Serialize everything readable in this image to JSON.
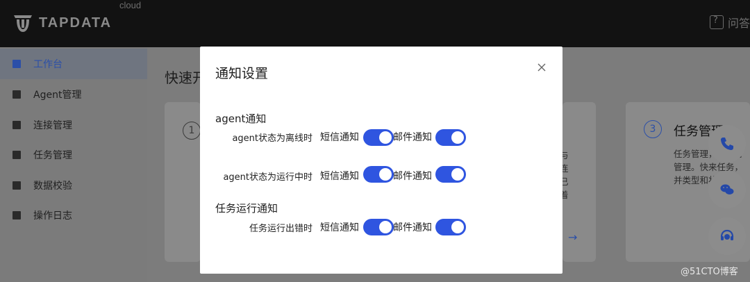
{
  "app": {
    "logo_text": "TAPDATA",
    "logo_sup": "cloud",
    "help_label": "问答"
  },
  "sidebar": {
    "items": [
      {
        "label": "工作台",
        "active": true
      },
      {
        "label": "Agent管理"
      },
      {
        "label": "连接管理"
      },
      {
        "label": "任务管理"
      },
      {
        "label": "数据校验"
      },
      {
        "label": "操作日志"
      }
    ]
  },
  "main": {
    "title": "快速开",
    "card1_num": "1",
    "card2_partial": "与连已着",
    "card3": {
      "num": "3",
      "title": "任务管理",
      "text": "任务管理，并进行管理。快来任务，并类型和状"
    }
  },
  "modal": {
    "title": "通知设置",
    "sections": [
      {
        "title": "agent通知",
        "rows": [
          {
            "label": "agent状态为离线时",
            "sms_label": "短信通知",
            "sms_on": true,
            "email_label": "邮件通知",
            "email_on": true
          },
          {
            "label": "agent状态为运行中时",
            "sms_label": "短信通知",
            "sms_on": true,
            "email_label": "邮件通知",
            "email_on": true
          }
        ]
      },
      {
        "title": "任务运行通知",
        "rows": [
          {
            "label": "任务运行出错时",
            "sms_label": "短信通知",
            "sms_on": true,
            "email_label": "邮件通知",
            "email_on": true
          }
        ]
      }
    ]
  },
  "watermark": "@51CTO博客",
  "colors": {
    "accent": "#2f55e0",
    "topbar": "#121212",
    "overlay": "#7c7c7c"
  }
}
